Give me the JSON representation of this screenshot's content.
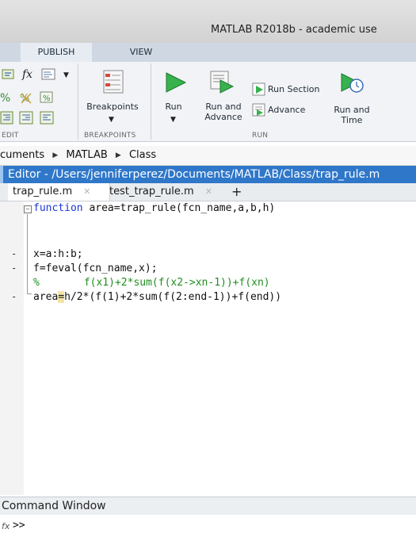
{
  "window": {
    "title": "MATLAB R2018b - academic use"
  },
  "tabs": {
    "publish": "PUBLISH",
    "view": "VIEW"
  },
  "toolstrip": {
    "breakpoints": "Breakpoints",
    "run": "Run",
    "run_and_advance_1": "Run and",
    "run_and_advance_2": "Advance",
    "run_section": "Run Section",
    "advance": "Advance",
    "run_and_time_1": "Run and",
    "run_and_time_2": "Time",
    "sections": {
      "edit": "EDIT",
      "breakpoints": "BREAKPOINTS",
      "run": "RUN"
    }
  },
  "breadcrumb": [
    "cuments",
    "MATLAB",
    "Class"
  ],
  "editor": {
    "title": "Editor - /Users/jenniferperez/Documents/MATLAB/Class/trap_rule.m",
    "tabs": [
      "trap_rule.m",
      "test_trap_rule.m"
    ],
    "code": {
      "l1_kw": "function",
      "l1_rest": " area=trap_rule(fcn_name,a,b,h)",
      "l2": "x=a:h:b;",
      "l3": "f=feval(fcn_name,x);",
      "l4_pct": "%",
      "l4_comment": "f(x1)+2*sum(f(x2->xn-1))+f(xn)",
      "l5_a": "area",
      "l5_eq": "=",
      "l5_b": "h/2*(f(1)+2*sum(f(2:end-1))+f(end))"
    }
  },
  "command_window": {
    "title": "Command Window",
    "prompt": ">>"
  },
  "colors": {
    "editor_title_bg": "#2f77c9",
    "keyword": "#1d36d6",
    "comment": "#1f8f1f"
  }
}
